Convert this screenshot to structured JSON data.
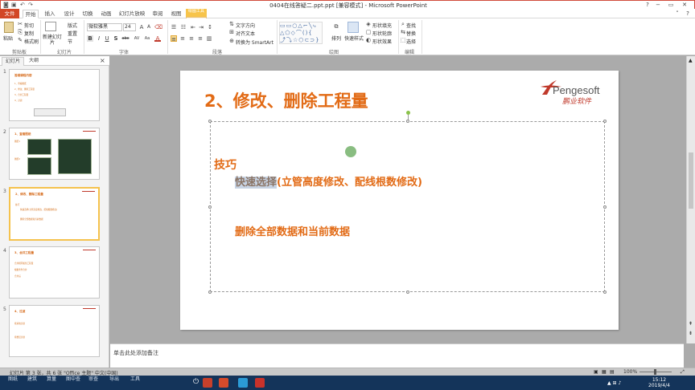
{
  "window": {
    "title": "0404在线答疑二.ppt.ppt [兼容模式] - Microsoft PowerPoint",
    "qat_icons": [
      "save-icon",
      "undo-icon",
      "redo-icon"
    ],
    "controls": [
      "−",
      "▭",
      "✕"
    ]
  },
  "tabs": {
    "file": "文件",
    "items": [
      "开始",
      "插入",
      "设计",
      "切换",
      "动画",
      "幻灯片放映",
      "审阅",
      "视图"
    ],
    "drawing_tools": "绘图工具",
    "format": "格式"
  },
  "ribbon": {
    "clipboard": {
      "paste": "粘贴",
      "cut": "剪切",
      "copy": "复制",
      "format_painter": "格式刷",
      "label": "剪贴板"
    },
    "slides": {
      "new_slide": "新建幻灯片",
      "layout": "版式",
      "reset": "重置",
      "section": "节",
      "label": "幻灯片"
    },
    "font": {
      "name": "微软雅黑",
      "size": "24",
      "label": "字体",
      "buttons": [
        "B",
        "I",
        "U",
        "S",
        "abc",
        "AV",
        "Aa",
        "A"
      ]
    },
    "paragraph": {
      "label": "段落",
      "text_direction": "文字方向",
      "align_text": "对齐文本",
      "smartart": "转换为 SmartArt"
    },
    "drawing": {
      "label": "绘图",
      "arrange": "排列",
      "quick_styles": "快速样式",
      "shape_fill": "形状填充",
      "shape_outline": "形状轮廓",
      "shape_effects": "形状效果"
    },
    "editing": {
      "label": "编辑",
      "find": "查找",
      "replace": "替换",
      "select": "选择"
    }
  },
  "panel": {
    "tabs": [
      "幻灯片",
      "大纲"
    ],
    "close": "×"
  },
  "thumbnails": [
    {
      "num": "1",
      "title": "答疑课程内容",
      "lines": [
        "1、查看图纸",
        "2、修改、删除工程量",
        "3、合并工程量",
        "4、过滤"
      ],
      "selected": false
    },
    {
      "num": "2",
      "title": "1、查看图纸",
      "lines": [
        "图纸1",
        "图纸2"
      ],
      "selected": false
    },
    {
      "num": "3",
      "title": "2、修改、删除工程量",
      "lines": [
        "技巧",
        "快速选择(立管高度修改、配线根数修改)",
        "删除全部数据和当前数据"
      ],
      "selected": true
    },
    {
      "num": "4",
      "title": "3、合并工程量",
      "lines": [
        "合并相同属性工程量",
        "根据条件合并",
        "合并后"
      ],
      "selected": false
    },
    {
      "num": "5",
      "title": "4、过滤",
      "lines": [
        "按系统过滤",
        "按楼层过滤"
      ],
      "selected": false
    }
  ],
  "slide": {
    "title": "2、修改、删除工程量",
    "logo_en": "Pengesoft",
    "logo_cn": "鹏业软件",
    "heading": "技巧",
    "line1_highlight": "快速选择",
    "line1_rest": "(立管高度修改、配线根数修改)",
    "line2": "删除全部数据和当前数据"
  },
  "notes": {
    "placeholder": "单击此处添加备注"
  },
  "status": {
    "text": "幻灯片 第 3 张，共 6 张    \"Office 主题\"    中文(中国)",
    "zoom": "100%"
  },
  "taskbar": {
    "items": [
      "图纸",
      "建筑",
      "算量",
      "图中查",
      "审查",
      "导出",
      "工具"
    ],
    "clock_time": "15:12",
    "clock_date": "2019/4/4"
  }
}
